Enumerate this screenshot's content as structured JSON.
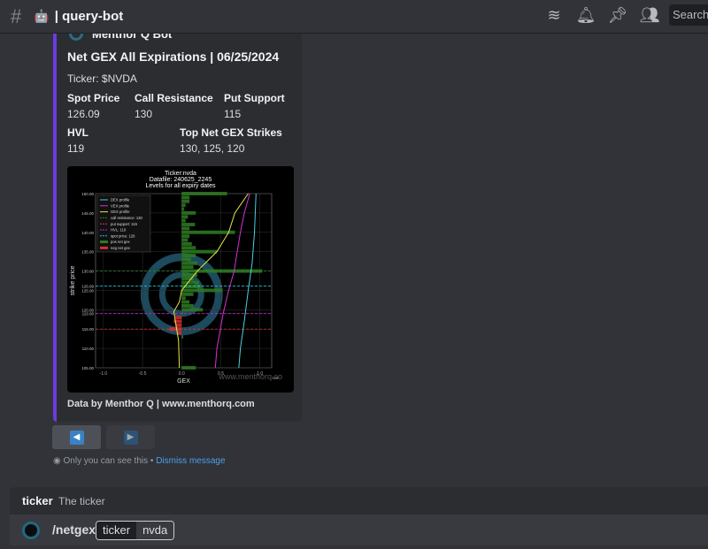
{
  "header": {
    "channel": "query-bot",
    "emoji": "🤖",
    "search_placeholder": "Search",
    "icons": [
      "threads-icon",
      "bell-icon",
      "pin-icon",
      "members-icon"
    ]
  },
  "embed": {
    "bot_name": "Menthor Q Bot",
    "title": "Net GEX All Expirations | 06/25/2024",
    "ticker": "Ticker: $NVDA",
    "fields": [
      {
        "name": "Spot Price",
        "value": "126.09"
      },
      {
        "name": "Call Resistance",
        "value": "130"
      },
      {
        "name": "Put Support",
        "value": "115"
      },
      {
        "name": "HVL",
        "value": "119"
      },
      {
        "name": "Top Net GEX Strikes",
        "value": "130, 125, 120"
      }
    ],
    "footer": "Data by Menthor Q | www.menthorq.com",
    "accent": "#6c3be0"
  },
  "chart_data": {
    "type": "bar",
    "title": "Ticker:nvda\nDatafile: 240625_2245\nLevels for all expiry dates",
    "title_lines": [
      "Ticker:nvda",
      "Datafile: 240625_2245",
      "Levels for all expiry dates"
    ],
    "xlabel": "GEX",
    "ylabel": "strike price",
    "x_exponent": "1e8",
    "xlim": [
      -1.1,
      1.15
    ],
    "ylim": [
      105,
      150
    ],
    "xticks": [
      "-1.0",
      "-0.5",
      "0.0",
      "0.5",
      "1.0"
    ],
    "yticks": [
      "150.00",
      "145.00",
      "140.00",
      "135.00",
      "130.00",
      "126.09",
      "125.00",
      "120.00",
      "119.00",
      "115.00",
      "110.00",
      "105.00"
    ],
    "watermark": "www.menthorq.co",
    "legend": [
      "DEX profile",
      "VEX profile",
      "GEX profile",
      "call resistance: 130",
      "put support: 115",
      "HVL: 119",
      "spot price: 126",
      "pos net gex",
      "neg net gex"
    ],
    "levels": [
      {
        "name": "call resistance",
        "value": 130,
        "color": "#2e7d32"
      },
      {
        "name": "spot price",
        "value": 126.09,
        "color": "#26c6da"
      },
      {
        "name": "HVL",
        "value": 119,
        "color": "#c026d3"
      },
      {
        "name": "put support",
        "value": 115,
        "color": "#e53935"
      }
    ],
    "strikes": [
      105,
      106,
      107,
      108,
      109,
      110,
      111,
      112,
      113,
      114,
      115,
      116,
      117,
      118,
      119,
      120,
      121,
      122,
      123,
      124,
      125,
      126,
      127,
      128,
      129,
      130,
      131,
      132,
      133,
      134,
      135,
      136,
      137,
      138,
      139,
      140,
      141,
      142,
      143,
      144,
      145,
      146,
      147,
      148,
      149,
      150
    ],
    "net_gex": [
      0.18,
      0,
      0,
      0,
      0,
      0,
      0,
      0,
      0.02,
      -0.05,
      -0.16,
      -0.08,
      -0.1,
      -0.08,
      0.02,
      0.27,
      0.15,
      0.1,
      0.05,
      0.15,
      0.52,
      0.25,
      0.22,
      0.15,
      0.2,
      1.03,
      0.15,
      0.2,
      0.12,
      0.18,
      0.45,
      0.18,
      0.13,
      0.08,
      0.1,
      0.68,
      0.1,
      0.17,
      0.05,
      0.08,
      0.18,
      0.03,
      0.05,
      0.1,
      0.1,
      0.58
    ],
    "series": [
      {
        "name": "DEX profile",
        "color": "#4dd0e1",
        "points": [
          [
            0.73,
            105
          ],
          [
            0.75,
            110
          ],
          [
            0.8,
            117
          ],
          [
            0.85,
            125
          ],
          [
            0.9,
            132
          ],
          [
            0.93,
            140
          ],
          [
            0.95,
            150
          ]
        ]
      },
      {
        "name": "VEX profile",
        "color": "#d633d6",
        "points": [
          [
            0.43,
            105
          ],
          [
            0.45,
            110
          ],
          [
            0.53,
            119
          ],
          [
            0.6,
            125
          ],
          [
            0.67,
            130
          ],
          [
            0.75,
            140
          ],
          [
            0.8,
            145
          ],
          [
            0.87,
            150
          ]
        ]
      },
      {
        "name": "GEX profile",
        "color": "#e6e64d",
        "points": [
          [
            -0.03,
            105
          ],
          [
            -0.04,
            112
          ],
          [
            -0.08,
            117
          ],
          [
            -0.1,
            119.5
          ],
          [
            -0.03,
            122
          ],
          [
            0,
            125
          ],
          [
            0.2,
            130
          ],
          [
            0.45,
            135
          ],
          [
            0.6,
            140
          ],
          [
            0.68,
            145
          ],
          [
            0.85,
            150
          ]
        ]
      }
    ]
  },
  "buttons": {
    "prev": "◀",
    "next": "▶"
  },
  "ephemeral": {
    "text": "Only you can see this • ",
    "link": "Dismiss message"
  },
  "option": {
    "name": "ticker",
    "desc": "The ticker"
  },
  "command": {
    "name": "/netgex",
    "param": "ticker",
    "value": "nvda"
  }
}
